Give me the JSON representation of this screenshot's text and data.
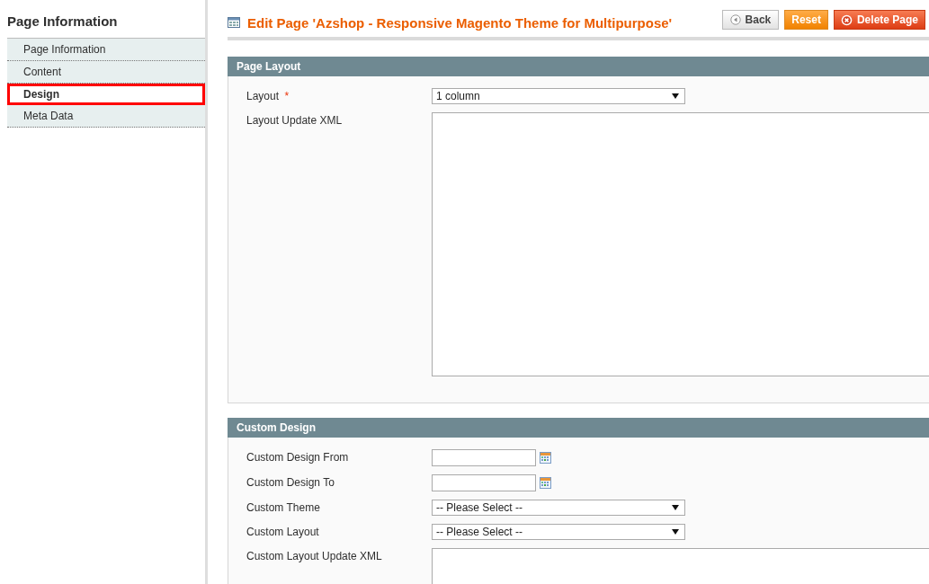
{
  "sidebar": {
    "title": "Page Information",
    "items": [
      {
        "label": "Page Information",
        "selected": false
      },
      {
        "label": "Content",
        "selected": false
      },
      {
        "label": "Design",
        "selected": true
      },
      {
        "label": "Meta Data",
        "selected": false
      }
    ]
  },
  "header": {
    "title": "Edit Page 'Azshop - Responsive Magento Theme for Multipurpose'",
    "buttons": [
      {
        "label": "Back",
        "kind": "back"
      },
      {
        "label": "Reset",
        "kind": "reset"
      },
      {
        "label": "Delete Page",
        "kind": "delete"
      }
    ]
  },
  "sections": [
    {
      "title": "Page Layout",
      "fields": [
        {
          "label": "Layout",
          "required_mark": "*",
          "kind": "select",
          "value": "1 column"
        },
        {
          "label": "Layout Update XML",
          "kind": "textarea"
        }
      ]
    },
    {
      "title": "Custom Design",
      "fields": [
        {
          "label": "Custom Design From",
          "kind": "date"
        },
        {
          "label": "Custom Design To",
          "kind": "date"
        },
        {
          "label": "Custom Theme",
          "kind": "select",
          "value": "-- Please Select --"
        },
        {
          "label": "Custom Layout",
          "kind": "select",
          "value": "-- Please Select --"
        },
        {
          "label": "Custom Layout Update XML",
          "kind": "textarea"
        }
      ]
    }
  ]
}
